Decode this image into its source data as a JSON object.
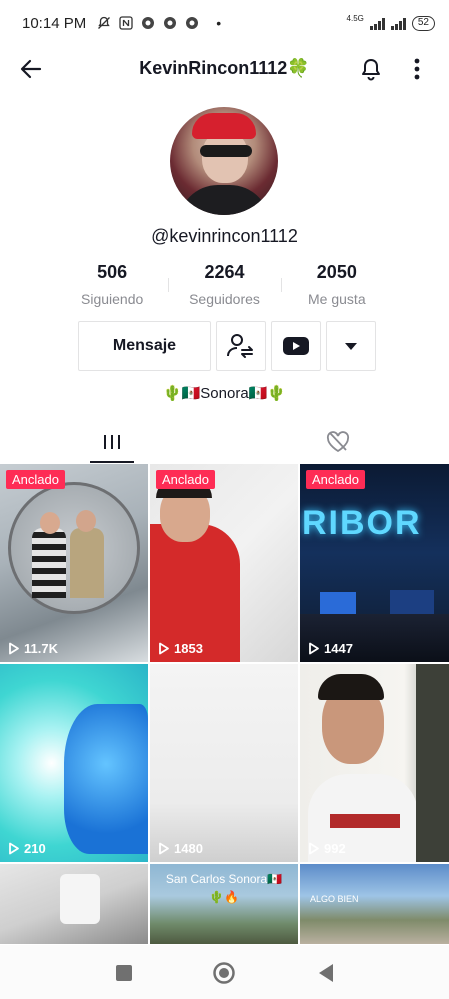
{
  "status": {
    "time": "10:14 PM",
    "network": "4.5G",
    "battery": "52"
  },
  "header": {
    "title": "KevinRincon1112🍀"
  },
  "profile": {
    "handle": "@kevinrincon1112",
    "stats": [
      {
        "value": "506",
        "label": "Siguiendo"
      },
      {
        "value": "2264",
        "label": "Seguidores"
      },
      {
        "value": "2050",
        "label": "Me gusta"
      }
    ],
    "message_button": "Mensaje",
    "bio": "🌵🇲🇽Sonora🇲🇽🌵"
  },
  "videos": [
    {
      "pinned": "Anclado",
      "views": "11.7K"
    },
    {
      "pinned": "Anclado",
      "views": "1853"
    },
    {
      "pinned": "Anclado",
      "views": "1447",
      "overlay": "RIBOR"
    },
    {
      "views": "210"
    },
    {
      "views": "1480"
    },
    {
      "views": "992"
    },
    {},
    {
      "overlay": "San Carlos Sonora🇲🇽",
      "overlay2": "🌵🔥"
    },
    {
      "overlay": "ALGO BIEN"
    }
  ],
  "colors": {
    "accent": "#fe2c55",
    "text": "#161823",
    "muted": "#8a8b91"
  }
}
